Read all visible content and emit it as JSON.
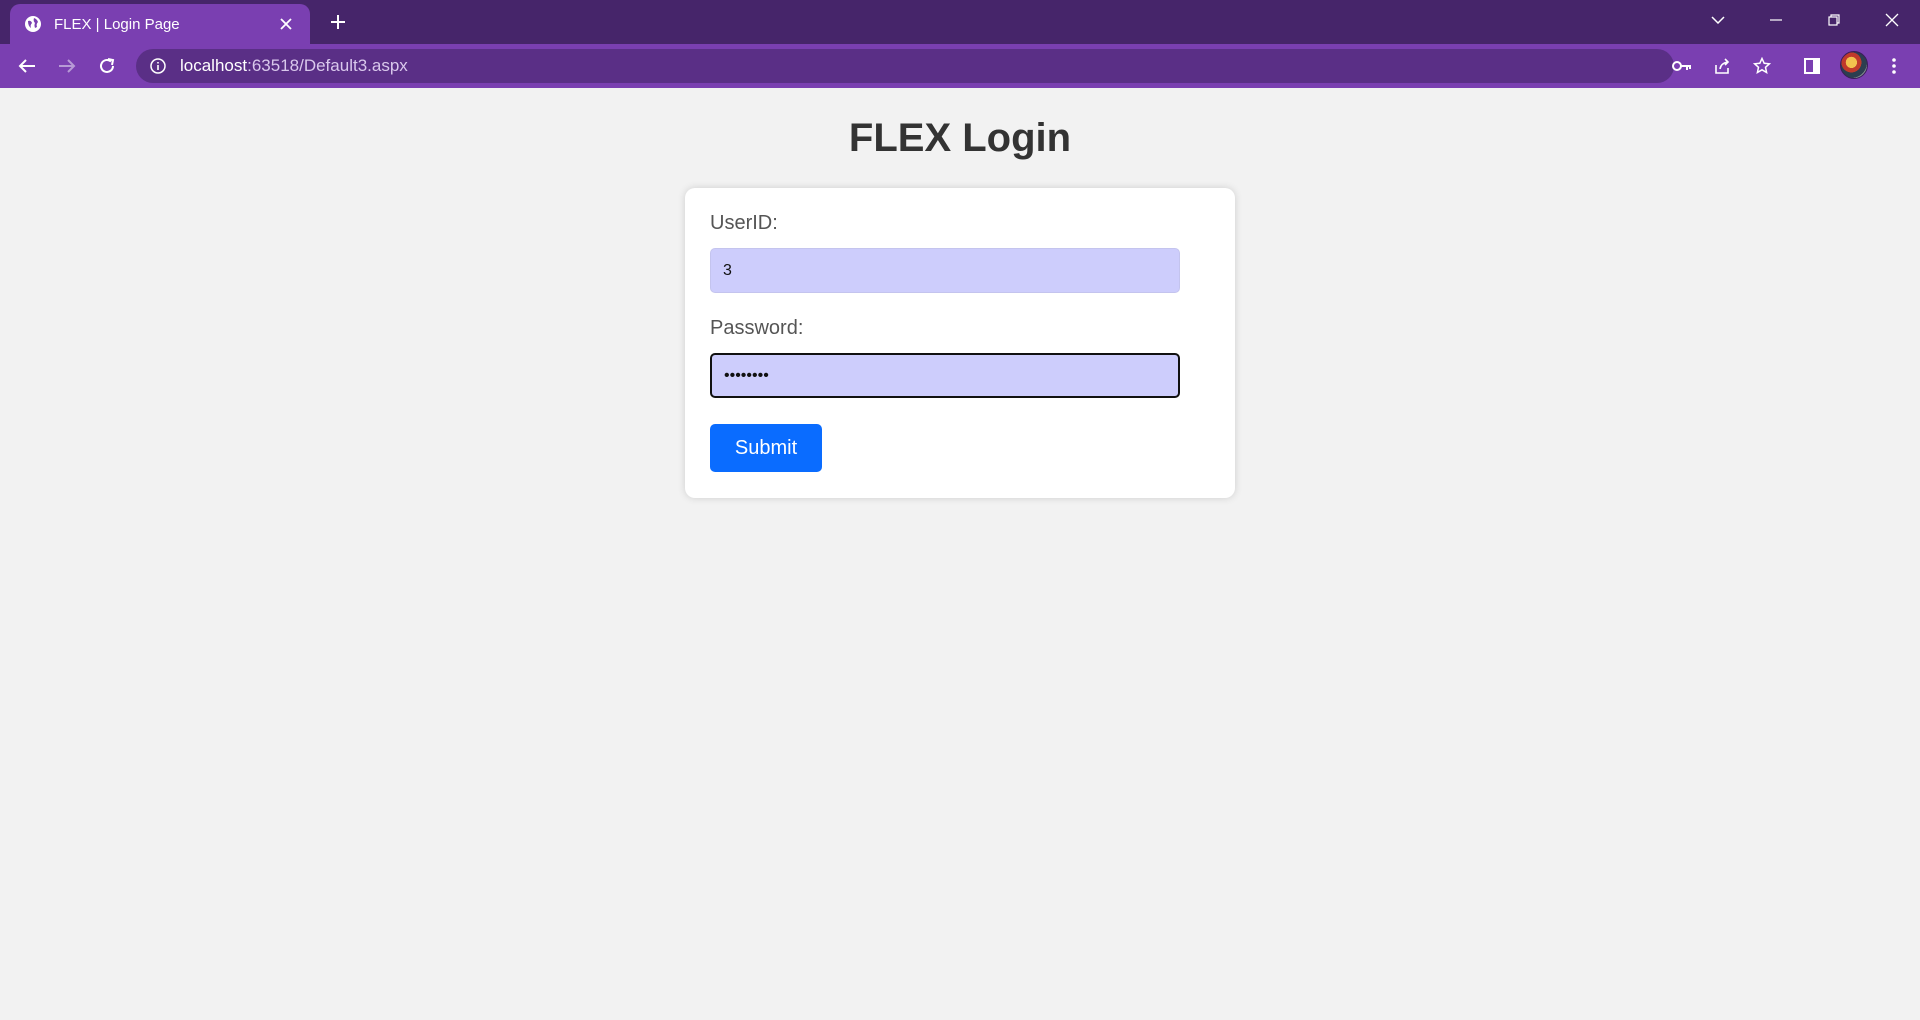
{
  "browser": {
    "tab_title": "FLEX | Login Page",
    "url_host": "localhost",
    "url_path": ":63518/Default3.aspx",
    "theme_colors": {
      "tabstrip": "#46256a",
      "toolbar": "#7a3fb1",
      "omnibox": "#5a2f86"
    }
  },
  "page": {
    "title": "FLEX Login",
    "userid_label": "UserID:",
    "userid_value": "3",
    "password_label": "Password:",
    "password_value": "••••••••",
    "submit_label": "Submit",
    "colors": {
      "input_bg": "#cdcdfc",
      "button_bg": "#0a6cff",
      "page_bg": "#f2f2f2"
    }
  }
}
